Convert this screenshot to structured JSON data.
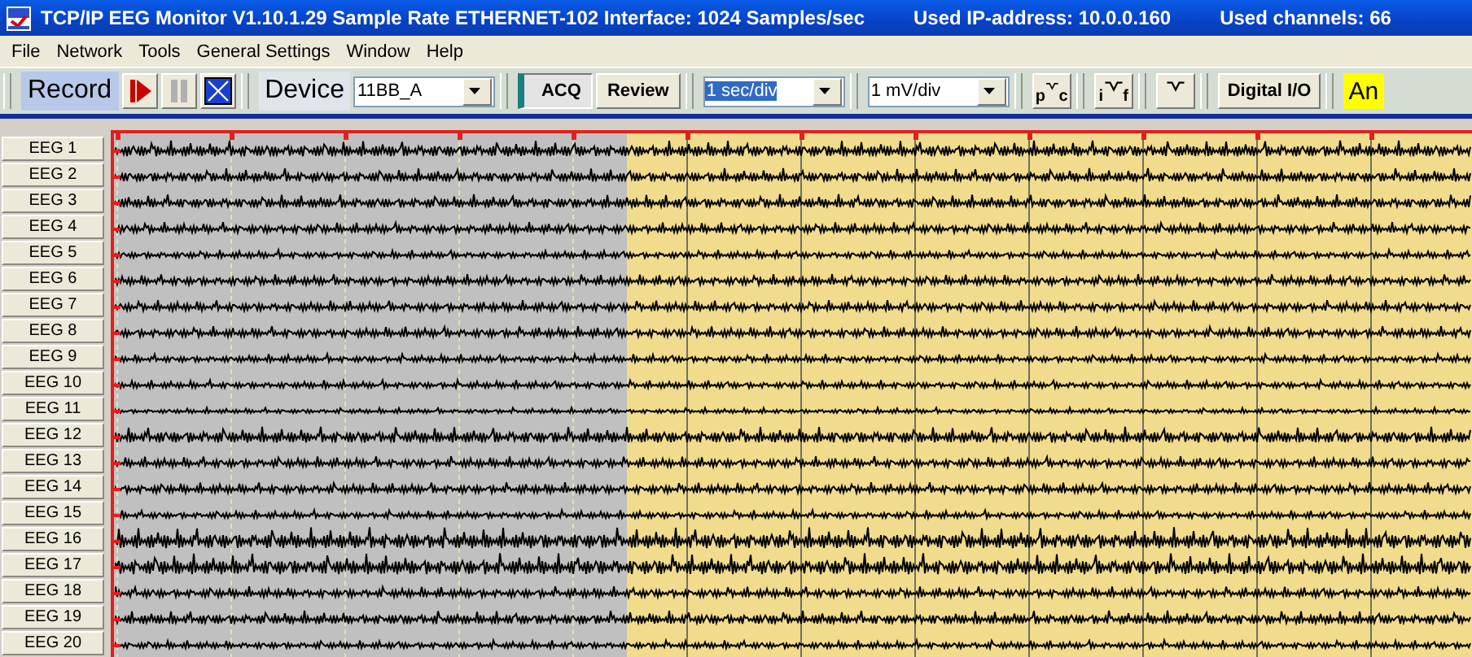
{
  "window": {
    "title_parts": [
      "TCP/IP EEG Monitor V1.10.1.29 Sample Rate ETHERNET-102 Interface: 1024 Samples/sec",
      "Used IP-address: 10.0.0.160",
      "Used channels: 66"
    ]
  },
  "menu": [
    "File",
    "Network",
    "Tools",
    "General Settings",
    "Window",
    "Help"
  ],
  "toolbar": {
    "groups": [
      [
        {
          "kind": "record-label",
          "text": "Record"
        },
        {
          "kind": "play-button",
          "disabled": false
        },
        {
          "kind": "pause-button",
          "disabled": true
        },
        {
          "kind": "stop-button",
          "disabled": false
        }
      ],
      [
        {
          "kind": "device-label",
          "text": "Device"
        },
        {
          "kind": "dropdown",
          "value": "11BB_A",
          "focused": false
        }
      ],
      [
        {
          "kind": "toggle",
          "text": "ACQ",
          "pressed": true
        },
        {
          "kind": "toggle",
          "text": "Review",
          "pressed": false
        }
      ],
      [
        {
          "kind": "dropdown",
          "value": "1 sec/div",
          "focused": true
        }
      ],
      [
        {
          "kind": "dropdown",
          "value": "1 mV/div",
          "focused": false
        }
      ],
      [
        {
          "kind": "glyph-button",
          "left": "p",
          "right": "c"
        }
      ],
      [
        {
          "kind": "glyph-button",
          "left": "i",
          "right": "f"
        }
      ],
      [
        {
          "kind": "glyph-button"
        }
      ],
      [
        {
          "kind": "button",
          "text": "Digital I/O",
          "highlight": false
        }
      ],
      [
        {
          "kind": "button",
          "text": "An",
          "highlight": true
        }
      ]
    ]
  },
  "channels": [
    {
      "label": "EEG 1"
    },
    {
      "label": "EEG 2"
    },
    {
      "label": "EEG 3"
    },
    {
      "label": "EEG 4"
    },
    {
      "label": "EEG 5"
    },
    {
      "label": "EEG 6"
    },
    {
      "label": "EEG 7"
    },
    {
      "label": "EEG 8"
    },
    {
      "label": "EEG 9"
    },
    {
      "label": "EEG 10"
    },
    {
      "label": "EEG 11"
    },
    {
      "label": "EEG 12"
    },
    {
      "label": "EEG 13"
    },
    {
      "label": "EEG 14"
    },
    {
      "label": "EEG 15"
    },
    {
      "label": "EEG 16"
    },
    {
      "label": "EEG 17"
    },
    {
      "label": "EEG 18"
    },
    {
      "label": "EEG 19"
    },
    {
      "label": "EEG 20"
    }
  ]
}
